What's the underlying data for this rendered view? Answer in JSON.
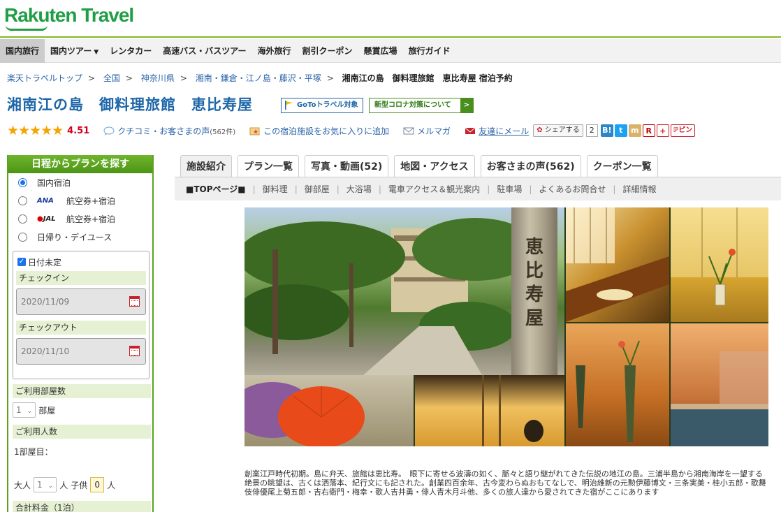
{
  "brand": {
    "logo_text": "Rakuten Travel"
  },
  "nav": {
    "items": [
      {
        "label": "国内旅行",
        "active": true
      },
      {
        "label": "国内ツアー",
        "caret": "▼"
      },
      {
        "label": "レンタカー"
      },
      {
        "label": "高速バス・バスツアー"
      },
      {
        "label": "海外旅行"
      },
      {
        "label": "割引クーポン"
      },
      {
        "label": "懸賞広場"
      },
      {
        "label": "旅行ガイド"
      }
    ]
  },
  "breadcrumb": {
    "items": [
      "楽天トラベルトップ",
      "全国",
      "神奈川県",
      "湘南・鎌倉・江ノ島・藤沢・平塚"
    ],
    "separator": ">",
    "current": "湘南江の島　御料理旅館　恵比寿屋 宿泊予約"
  },
  "hotel": {
    "title": "湘南江の島　御料理旅館　恵比寿屋",
    "goto_badge": "GoToトラベル対象",
    "covid_badge": "新型コロナ対策について",
    "covid_arrow": ">"
  },
  "rating": {
    "stars": "★★★★★",
    "score": "4.51",
    "reviews_label": "クチコミ・お客さまの声",
    "reviews_count": "(562件)",
    "favorite_label": "この宿泊施設をお気に入りに追加",
    "mailmag_label": "メルマガ",
    "friend_label": "友達にメール",
    "share_label": "シェアする",
    "share_count": "2",
    "hatena": "B!",
    "twitter": "t",
    "mixi": "m",
    "rakuten_r": "R",
    "plus": "+",
    "pin_label": "ピン"
  },
  "sidebar": {
    "header": "日程からプランを探す",
    "options": [
      {
        "label": "国内宿泊",
        "checked": true
      },
      {
        "label": "航空券+宿泊",
        "airline": "ANA"
      },
      {
        "label": "航空券+宿泊",
        "airline": "JAL"
      },
      {
        "label": "日帰り・デイユース"
      }
    ],
    "date_undecided": "日付未定",
    "checkin_label": "チェックイン",
    "checkin_value": "2020/11/09",
    "checkout_label": "チェックアウト",
    "checkout_value": "2020/11/10",
    "rooms_label": "ご利用部屋数",
    "rooms_value": "1",
    "rooms_unit": "部屋",
    "people_label": "ご利用人数",
    "room1_label": "1部屋目：",
    "adult_label": "大人",
    "adult_value": "1",
    "adult_unit": "人",
    "child_label": "子供",
    "child_value": "0",
    "child_unit": "人",
    "total_label": "合計料金（1泊）"
  },
  "tabs": [
    {
      "label": "施設紹介",
      "active": true
    },
    {
      "label": "プラン一覧"
    },
    {
      "label": "写真・動画(52)"
    },
    {
      "label": "地図・アクセス"
    },
    {
      "label": "お客さまの声(562)"
    },
    {
      "label": "クーポン一覧"
    }
  ],
  "subnav": [
    {
      "label": "■TOPページ■",
      "active": true
    },
    {
      "label": "御料理"
    },
    {
      "label": "御部屋"
    },
    {
      "label": "大浴場"
    },
    {
      "label": "電車アクセス＆観光案内"
    },
    {
      "label": "駐車場"
    },
    {
      "label": "よくあるお問合せ"
    },
    {
      "label": "詳細情報"
    }
  ],
  "photo": {
    "sign_text": "恵比寿屋"
  },
  "description": "創業江戸時代初期。島に弁天、旅館は恵比寿。　眼下に寄せる波濤の如く、脈々と語り継がれてきた伝説の地江の島。三浦半島から湘南海岸を一望する絶景の眺望は、古くは洒落本、紀行文にも記された。創業四百余年、古今変わらぬおもてなしで、明治維新の元勲伊藤博文・三条実美・桂小五郎・歌舞伎俳優尾上菊五郎・吉右衛門・梅幸・歌人吉井勇・俳人青木月斗他、多くの旅人達から愛されてきた宿がここにあります",
  "colors": {
    "brand_green": "#1f9e46",
    "link_blue": "#2a63a8",
    "title_blue": "#1d66a8",
    "score_red": "#d0021b",
    "star_gold": "#f2a400"
  }
}
